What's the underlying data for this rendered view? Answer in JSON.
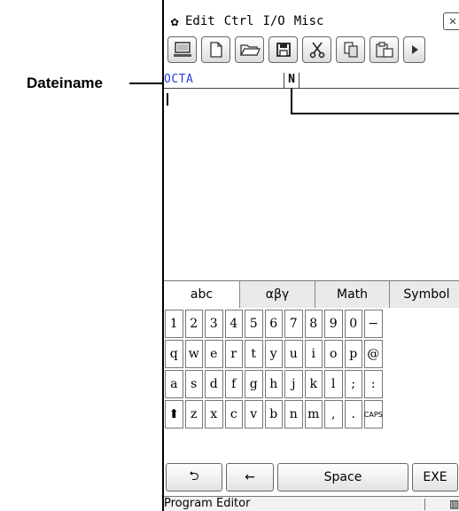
{
  "annotation": {
    "callout_label": "Dateiname"
  },
  "menubar": {
    "gear_icon": "gear-icon",
    "items": [
      {
        "label": "Edit"
      },
      {
        "label": "Ctrl"
      },
      {
        "label": "I/O"
      },
      {
        "label": "Misc"
      }
    ],
    "close_icon": "close-icon"
  },
  "toolbar": {
    "icons": [
      "computer-icon",
      "new-file-icon",
      "open-folder-icon",
      "save-icon",
      "cut-icon",
      "copy-icon",
      "paste-icon",
      "more-icon"
    ]
  },
  "file": {
    "name": "OCTA",
    "type_marker": "N"
  },
  "editor": {
    "content": ""
  },
  "keyboard": {
    "tabs": [
      {
        "label": "abc",
        "active": true
      },
      {
        "label": "αβγ",
        "active": false
      },
      {
        "label": "Math",
        "active": false
      },
      {
        "label": "Symbol",
        "active": false
      }
    ],
    "rows": [
      [
        "1",
        "2",
        "3",
        "4",
        "5",
        "6",
        "7",
        "8",
        "9",
        "0",
        "−"
      ],
      [
        "q",
        "w",
        "e",
        "r",
        "t",
        "y",
        "u",
        "i",
        "o",
        "p",
        "@"
      ],
      [
        "a",
        "s",
        "d",
        "f",
        "g",
        "h",
        "j",
        "k",
        "l",
        ";",
        ":"
      ],
      [
        "⬆",
        "z",
        "x",
        "c",
        "v",
        "b",
        "n",
        "m",
        ",",
        ".",
        "CAPS"
      ]
    ],
    "bottom": {
      "return_label": "⮌",
      "backspace_label": "←",
      "space_label": "Space",
      "exe_label": "EXE"
    }
  },
  "status": {
    "app_name": "Program Editor",
    "battery_icon": "battery-icon"
  }
}
